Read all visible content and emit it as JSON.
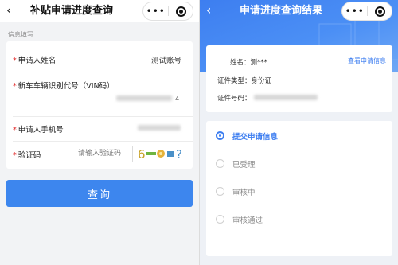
{
  "left": {
    "title": "补贴申请进度查询",
    "back_icon": "chevron-left-icon",
    "more_label": "•••",
    "section_label": "信息填写",
    "fields": {
      "name_label": "申请人姓名",
      "name_value": "测试账号",
      "vin_label": "新车车辆识别代号（VIN码）",
      "vin_value": "4",
      "phone_label": "申请人手机号",
      "captcha_label": "验证码",
      "captcha_placeholder": "请输入验证码"
    },
    "required_mark": "*",
    "query_button": "查询"
  },
  "right": {
    "title": "申请进度查询结果",
    "back_icon": "chevron-left-icon",
    "more_label": "•••",
    "info": {
      "name_key": "姓名：",
      "name_value": "测***",
      "view_link": "查看申请信息",
      "id_type_key": "证件类型：",
      "id_type_value": "身份证",
      "id_no_key": "证件号码："
    },
    "steps": [
      {
        "label": "提交申请信息",
        "active": true
      },
      {
        "label": "已受理",
        "active": false
      },
      {
        "label": "审核中",
        "active": false
      },
      {
        "label": "审核通过",
        "active": false
      }
    ]
  },
  "colors": {
    "accent": "#3d86ee",
    "required": "#e02020",
    "link": "#3d7ef0"
  }
}
